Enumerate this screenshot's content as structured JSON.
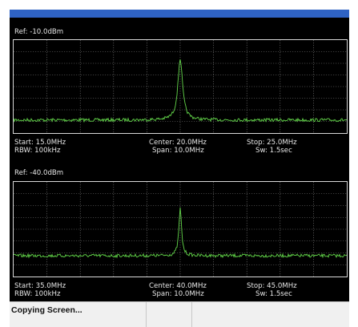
{
  "status_bar": {
    "message": "Copying Screen..."
  },
  "colors": {
    "title_bar": "#2f63c4",
    "trace": "#63d64a",
    "grid": "#7a7a7a",
    "background": "#000000",
    "text": "#e6e6e6"
  },
  "panels": [
    {
      "ref": "Ref: -10.0dBm",
      "start": "Start: 15.0MHz",
      "center": "Center: 20.0MHz",
      "stop": "Stop: 25.0MHz",
      "rbw": "RBW: 100kHz",
      "span": "Span: 10.0MHz",
      "sw": "Sw: 1.5sec"
    },
    {
      "ref": "Ref: -40.0dBm",
      "start": "Start: 35.0MHz",
      "center": "Center: 40.0MHz",
      "stop": "Stop: 45.0MHz",
      "rbw": "RBW: 100kHz",
      "span": "Span: 10.0MHz",
      "sw": "Sw: 1.5sec"
    }
  ]
}
